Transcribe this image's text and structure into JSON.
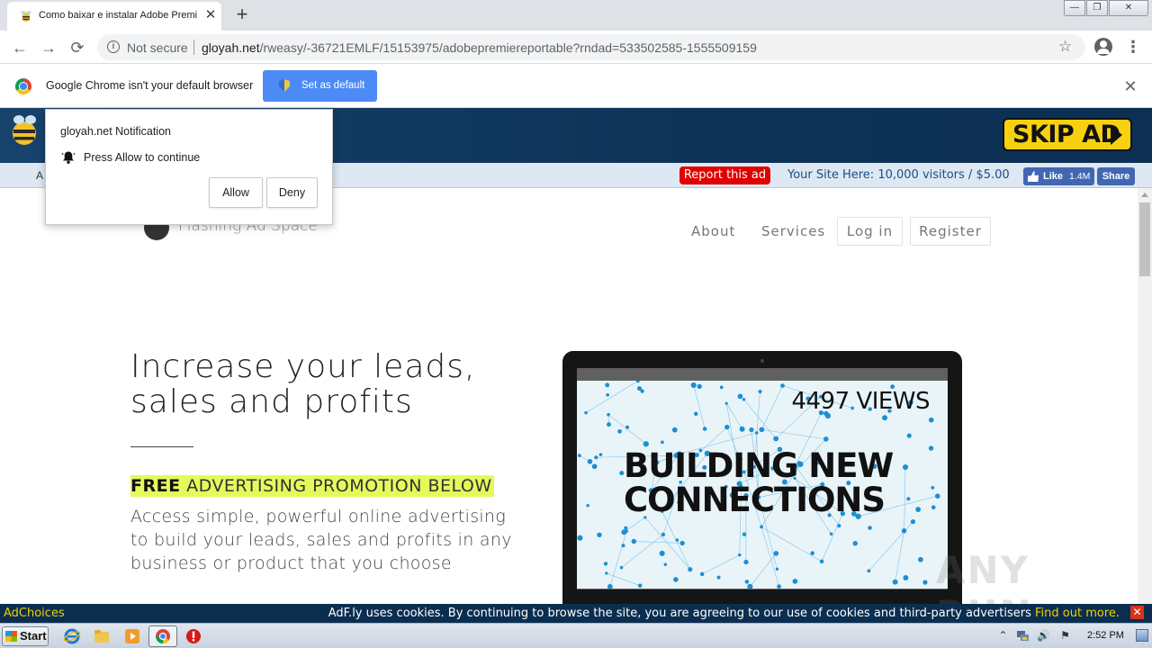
{
  "browser": {
    "tab": {
      "title": "Como baixar e instalar Adobe Premiere",
      "close_glyph": "✕"
    },
    "new_tab_glyph": "+",
    "window_controls": {
      "minimize": "—",
      "maximize": "❐",
      "close": "✕"
    },
    "nav": {
      "back": "←",
      "forward": "→",
      "reload": "⟳"
    },
    "omnibox": {
      "security_label": "Not secure",
      "url_host": "gloyah.net",
      "url_path": "/rweasy/-36721EMLF/15153975/adobepremiereportable?rndad=533502585-1555509159"
    },
    "star_glyph": "☆",
    "menu_glyph": "⋮"
  },
  "infobar": {
    "message": "Google Chrome isn't your default browser",
    "button_label": "Set as default",
    "close_glyph": "✕"
  },
  "ad_banner": {
    "skip_label": "SKIP AD",
    "left_fragment": "A",
    "report_label": "Report this ad",
    "your_site_text": "Your Site Here: 10,000 visitors / $5.00",
    "fb_like_label": "Like",
    "fb_like_count": "1.4M",
    "fb_share_label": "Share"
  },
  "notification": {
    "title": "gloyah.net Notification",
    "message": "Press Allow to continue",
    "allow_label": "Allow",
    "deny_label": "Deny"
  },
  "site": {
    "name": "Flashing Ad Space",
    "nav": {
      "about": "About",
      "services": "Services",
      "login": "Log in",
      "register": "Register"
    },
    "hero": {
      "title": "Increase your leads, sales and profits",
      "promo_bold": "FREE",
      "promo_rest": "ADVERTISING PROMOTION BELOW",
      "body": "Access simple, powerful online advertising to build your leads, sales and profits in any business or product that you choose"
    },
    "laptop_screen": {
      "views": "4497 VIEWS",
      "headline": "BUILDING NEW CONNECTIONS"
    },
    "watermark": "ANY RUN"
  },
  "cookie_bar": {
    "adchoices": "AdChoices",
    "text": "AdF.ly uses cookies. By continuing to browse the site, you are agreeing to our use of cookies and third-party advertisers",
    "link": "Find out more.",
    "close_glyph": "✕"
  },
  "taskbar": {
    "start_label": "Start",
    "clock": "2:52 PM",
    "tray": {
      "up_arrow": "⌃",
      "volume": "🔊",
      "flag": "⚑"
    }
  },
  "colors": {
    "chrome_blue": "#4c8bf5",
    "banner_navy": "#0e3357",
    "skip_yellow": "#f7d110",
    "report_red": "#e10000",
    "promo_highlight": "#e6f95a",
    "adchoices_yellow": "#f0d000"
  }
}
